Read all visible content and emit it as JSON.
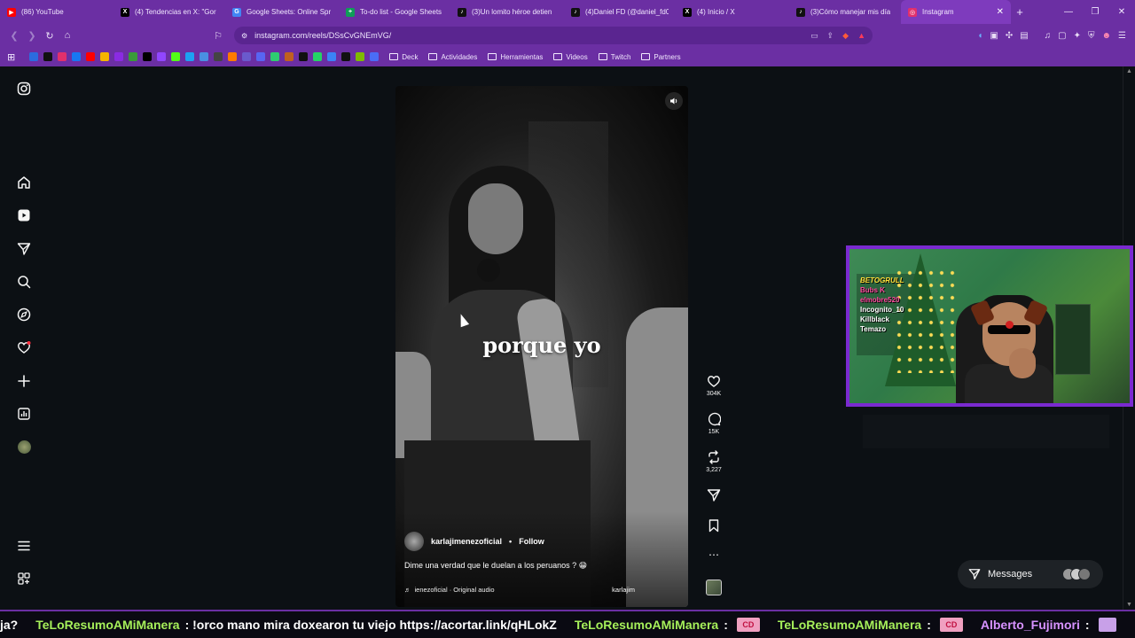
{
  "tabs": [
    {
      "label": "(86) YouTube",
      "color": "#ff0000",
      "glyph": "▶",
      "width": 128
    },
    {
      "label": "(4) Tendencias en X: \"Gor",
      "color": "#000000",
      "glyph": "X",
      "width": 126
    },
    {
      "label": "Google Sheets: Online Spr",
      "color": "#4285f4",
      "glyph": "G",
      "width": 128
    },
    {
      "label": "To-do list - Google Sheets",
      "color": "#0f9d58",
      "glyph": "+",
      "width": 126
    },
    {
      "label": "(3)Un lomito héroe detien",
      "color": "#111111",
      "glyph": "♪",
      "width": 128
    },
    {
      "label": "(4)Daniel FD (@daniel_fd0",
      "color": "#111111",
      "glyph": "♪",
      "width": 126
    },
    {
      "label": "(4) Inicio / X",
      "color": "#000000",
      "glyph": "X",
      "width": 128
    },
    {
      "label": "(3)Cómo manejar mis día",
      "color": "#111111",
      "glyph": "♪",
      "width": 126
    },
    {
      "label": "Instagram",
      "color": "#e1306c",
      "glyph": "◎",
      "width": 124,
      "active": true
    }
  ],
  "address": {
    "url": "instagram.com/reels/DSsCvGNEmVG/"
  },
  "bookmarks": {
    "icons": [
      "#2b6cdf",
      "#111111",
      "#e1306c",
      "#1877f2",
      "#ff0000",
      "#f5b400",
      "#8a2be2",
      "#3a9a3a",
      "#000000",
      "#9146ff",
      "#53fc18",
      "#1da1f2",
      "#4a90e2",
      "#444444",
      "#ff7a00",
      "#6a5acd",
      "#5865f2",
      "#2ecc71",
      "#c06020",
      "#111111",
      "#25d366",
      "#3b82f6",
      "#111111",
      "#7fba00",
      "#4a6cf7"
    ],
    "folders": [
      "Deck",
      "Actividades",
      "Herramientas",
      "Videos",
      "Twitch",
      "Partners"
    ]
  },
  "reel": {
    "caption": "porque yo",
    "author": "karlajimenezoficial",
    "follow": "Follow",
    "separator": "•",
    "description": "Dime una verdad que le duelan a los peruanos ? 😁",
    "audio": "ienezoficial · Original audio",
    "audio_user": "karlajim"
  },
  "actions": {
    "likes": "304K",
    "comments": "15K",
    "reposts": "3,227"
  },
  "cam": {
    "names": [
      "BETOGRULL",
      "Bubs K",
      "elmobre520",
      "Incognito_10",
      "Killblack",
      "Temazo"
    ]
  },
  "messages": {
    "label": "Messages"
  },
  "ticker": {
    "lead": "ja?",
    "items": [
      {
        "user": "TeLoResumoAMiManera",
        "text": ": !orco mano mira doxearon tu viejo https://acortar.link/qHLokZ"
      },
      {
        "user": "TeLoResumoAMiManera",
        "text": ":",
        "emote": "CD"
      },
      {
        "user": "TeLoResumoAMiManera",
        "text": ":",
        "emote": "CD"
      },
      {
        "user": "Alberto_Fujimori",
        "text": ":",
        "emote": ""
      }
    ]
  }
}
